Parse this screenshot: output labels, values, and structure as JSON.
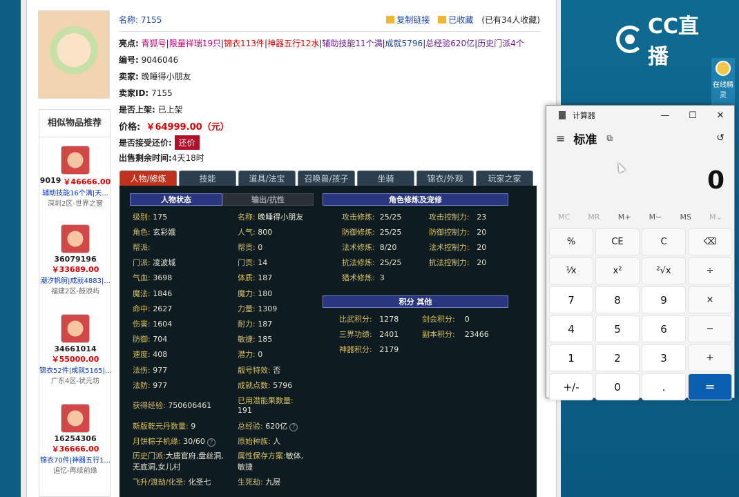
{
  "overlay": {
    "brand": "CC直播",
    "elf_label": "在线精灵"
  },
  "similar": {
    "title": "相似物品推荐",
    "items": [
      {
        "id": "9019",
        "price": "￥46666.00",
        "tags": "辅助技能16个满|天...",
        "server": "深圳2区-世界之窗"
      },
      {
        "id": "36079196",
        "price": "￥33689.00",
        "tags": "潮汐帆舸|成就4883|...",
        "server": "福建2区-鼓浪屿"
      },
      {
        "id": "34661014",
        "price": "￥55000.00",
        "tags": "锦衣52件|成就5165|...",
        "server": "广东4区-状元坊"
      },
      {
        "id": "16254306",
        "price": "￥36666.00",
        "tags": "锦衣70件|神器五行1...",
        "server": "追忆-再续前缘"
      }
    ]
  },
  "info": {
    "name_label": "名称:",
    "name": "7155",
    "copy_link": "复制链接",
    "favorited": "已收藏",
    "fav_count": "(已有34人收藏)",
    "highlights_label": "亮点:",
    "highlights": [
      "青狐号",
      "限量祥瑞19只",
      "锦衣113件",
      "神器五行12水",
      "辅助技能11个满",
      "成就5796",
      "总经验620亿",
      "历史门派4个"
    ],
    "id_label": "编号:",
    "id": "9046046",
    "seller_label": "卖家:",
    "seller": "晚睡得小朋友",
    "seller_id_label": "卖家ID:",
    "seller_id": "7155",
    "listed_label": "是否上架:",
    "listed": "已上架",
    "price_label": "价格:",
    "price": "￥64999.00（元）",
    "bargain_label": "是否接受还价:",
    "bargain_btn": "还价",
    "remaining_label": "出售剩余时间:",
    "remaining": "4天18时"
  },
  "tabs": [
    "人物/修炼",
    "技能",
    "道具/法宝",
    "召唤兽/孩子",
    "坐骑",
    "锦衣/外观",
    "玩家之家"
  ],
  "panel": {
    "hdr_status": "人物状态",
    "hdr_resist": "输出/抗性",
    "hdr_cultivation": "角色修炼及宠修",
    "hdr_points": "积分 其他",
    "left": [
      {
        "k": "级别:",
        "v": "175"
      },
      {
        "k": "角色:",
        "v": "玄彩娥"
      },
      {
        "k": "帮派:",
        "v": ""
      },
      {
        "k": "门派:",
        "v": "凌波城"
      },
      {
        "k": "气血:",
        "v": "3698"
      },
      {
        "k": "魔法:",
        "v": "1846"
      },
      {
        "k": "命中:",
        "v": "2627"
      },
      {
        "k": "伤害:",
        "v": "1604"
      },
      {
        "k": "防御:",
        "v": "704"
      },
      {
        "k": "速度:",
        "v": "408"
      },
      {
        "k": "法伤:",
        "v": "977"
      },
      {
        "k": "法防:",
        "v": "977"
      }
    ],
    "mid": [
      {
        "k": "名称:",
        "v": "晚睡得小朋友"
      },
      {
        "k": "人气:",
        "v": "800"
      },
      {
        "k": "帮贡:",
        "v": "0"
      },
      {
        "k": "门贡:",
        "v": "14"
      },
      {
        "k": "体质:",
        "v": "187"
      },
      {
        "k": "魔力:",
        "v": "180"
      },
      {
        "k": "力量:",
        "v": "1309"
      },
      {
        "k": "耐力:",
        "v": "187"
      },
      {
        "k": "敏捷:",
        "v": "185"
      },
      {
        "k": "潜力:",
        "v": "0"
      },
      {
        "k": "靓号特效:",
        "v": "否"
      },
      {
        "k": "成就点数:",
        "v": "5796"
      }
    ],
    "exp_k": "获得经验:",
    "exp_v": "750606461",
    "used_pot_k": "已用潜能果数量:",
    "used_pot_v": "191",
    "qiankun_k": "新版乾元丹数量:",
    "qiankun_v": "9",
    "total_exp_k": "总经验:",
    "total_exp_v": "620亿",
    "zongzi_k": "月饼粽子机缘:",
    "zongzi_v": "30/60",
    "race_k": "原始种族:",
    "race_v": "人",
    "history_k": "历史门派:",
    "history_v": "大唐官府,盘丝洞,无底洞,女儿村",
    "attr_k": "属性保存方案:",
    "attr_v": "敏体,敏捷",
    "fly_k": "飞升/渡劫/化圣:",
    "fly_v": "化圣七",
    "life_k": "生死劫:",
    "life_v": "九层",
    "cult": [
      {
        "k": "攻击修炼:",
        "v": "25/25"
      },
      {
        "k": "防御修炼:",
        "v": "25/25"
      },
      {
        "k": "法术修炼:",
        "v": "8/20"
      },
      {
        "k": "抗法修炼:",
        "v": "25/25"
      },
      {
        "k": "猎术修炼:",
        "v": "3"
      }
    ],
    "ctrl": [
      {
        "k": "攻击控制力:",
        "v": "23"
      },
      {
        "k": "防御控制力:",
        "v": "20"
      },
      {
        "k": "法术控制力:",
        "v": "20"
      },
      {
        "k": "抗法控制力:",
        "v": "20"
      }
    ],
    "pts": [
      {
        "k": "比武积分:",
        "v": "1278"
      },
      {
        "k": "三界功绩:",
        "v": "2401"
      },
      {
        "k": "神器积分:",
        "v": "2179"
      }
    ],
    "pts2": [
      {
        "k": "剑会积分:",
        "v": "0"
      },
      {
        "k": "副本积分:",
        "v": "23466"
      }
    ]
  },
  "calculator": {
    "title": "计算器",
    "mode": "标准",
    "display": "0",
    "memory": [
      "MC",
      "MR",
      "M+",
      "M−",
      "MS",
      "M⌄"
    ],
    "keys": [
      "%",
      "CE",
      "C",
      "⌫",
      "¹⁄x",
      "x²",
      "²√x",
      "÷",
      "7",
      "8",
      "9",
      "×",
      "4",
      "5",
      "6",
      "−",
      "1",
      "2",
      "3",
      "+",
      "+/-",
      "0",
      ".",
      "="
    ]
  }
}
